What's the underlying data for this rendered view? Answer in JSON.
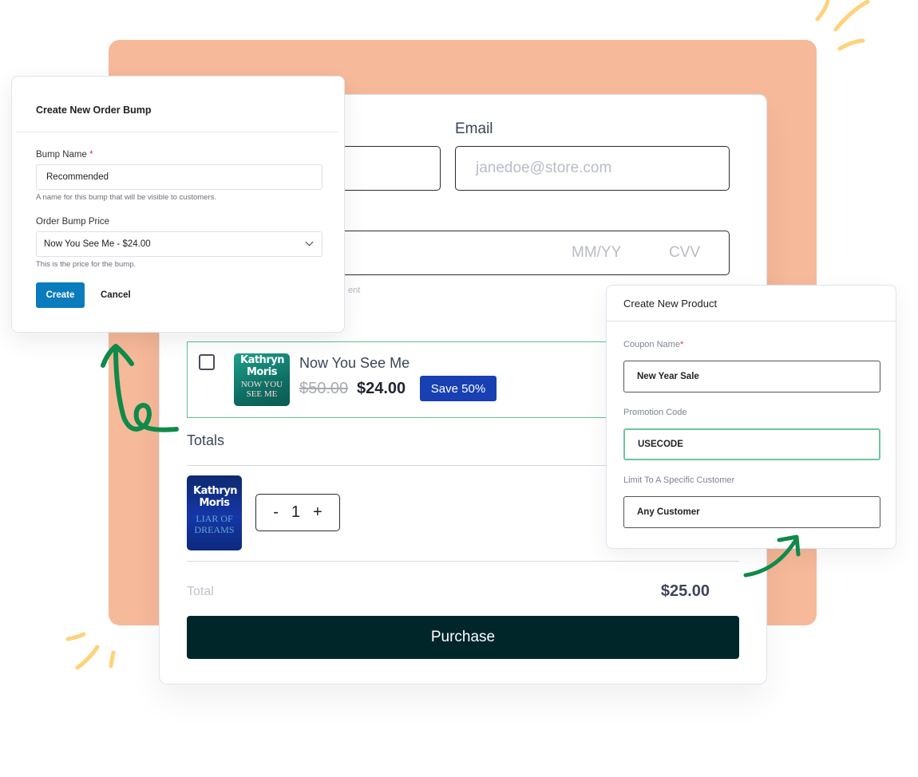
{
  "checkout": {
    "email_label": "Email",
    "email_placeholder": "janedoe@store.com",
    "card_exp_placeholder": "MM/YY",
    "card_cvv_placeholder": "CVV",
    "card_hint_fragment": "ent",
    "order_bump": {
      "checked": false,
      "book_author": "Kathryn Moris",
      "book_title": "NOW YOU SEE ME",
      "name": "Now You See Me",
      "original_price": "$50.00",
      "price": "$24.00",
      "badge": "Save 50%"
    },
    "totals_heading": "Totals",
    "line_item": {
      "book_author": "Kathryn Moris",
      "book_title": "LIAR OF DREAMS",
      "qty_minus": "-",
      "quantity": "1",
      "qty_plus": "+"
    },
    "total_label": "Total",
    "total_value": "$25.00",
    "purchase_label": "Purchase"
  },
  "bump_modal": {
    "title": "Create New Order Bump",
    "name_label": "Bump Name",
    "required_mark": "*",
    "name_value": "Recommended",
    "name_hint": "A name for this bump that will be visible to customers.",
    "price_label": "Order Bump Price",
    "price_value": "Now You See Me - $24.00",
    "price_hint": "This is the price for the bump.",
    "create_label": "Create",
    "cancel_label": "Cancel"
  },
  "product_modal": {
    "title": "Create New Product",
    "coupon_label": "Coupon Name",
    "required_mark": "*",
    "coupon_value": "New Year Sale",
    "promo_label": "Promotion Code",
    "promo_value": "USECODE",
    "limit_label": "Limit To A Specific Customer",
    "limit_value": "Any Customer"
  },
  "colors": {
    "peach": "#f6b999",
    "accent_green": "#5fc291",
    "arrow_green": "#0f8a4a",
    "badge_blue": "#1840b3",
    "create_blue": "#0a7bbd",
    "purchase_bg": "#00262a",
    "deco_yellow": "#ffd27a"
  }
}
